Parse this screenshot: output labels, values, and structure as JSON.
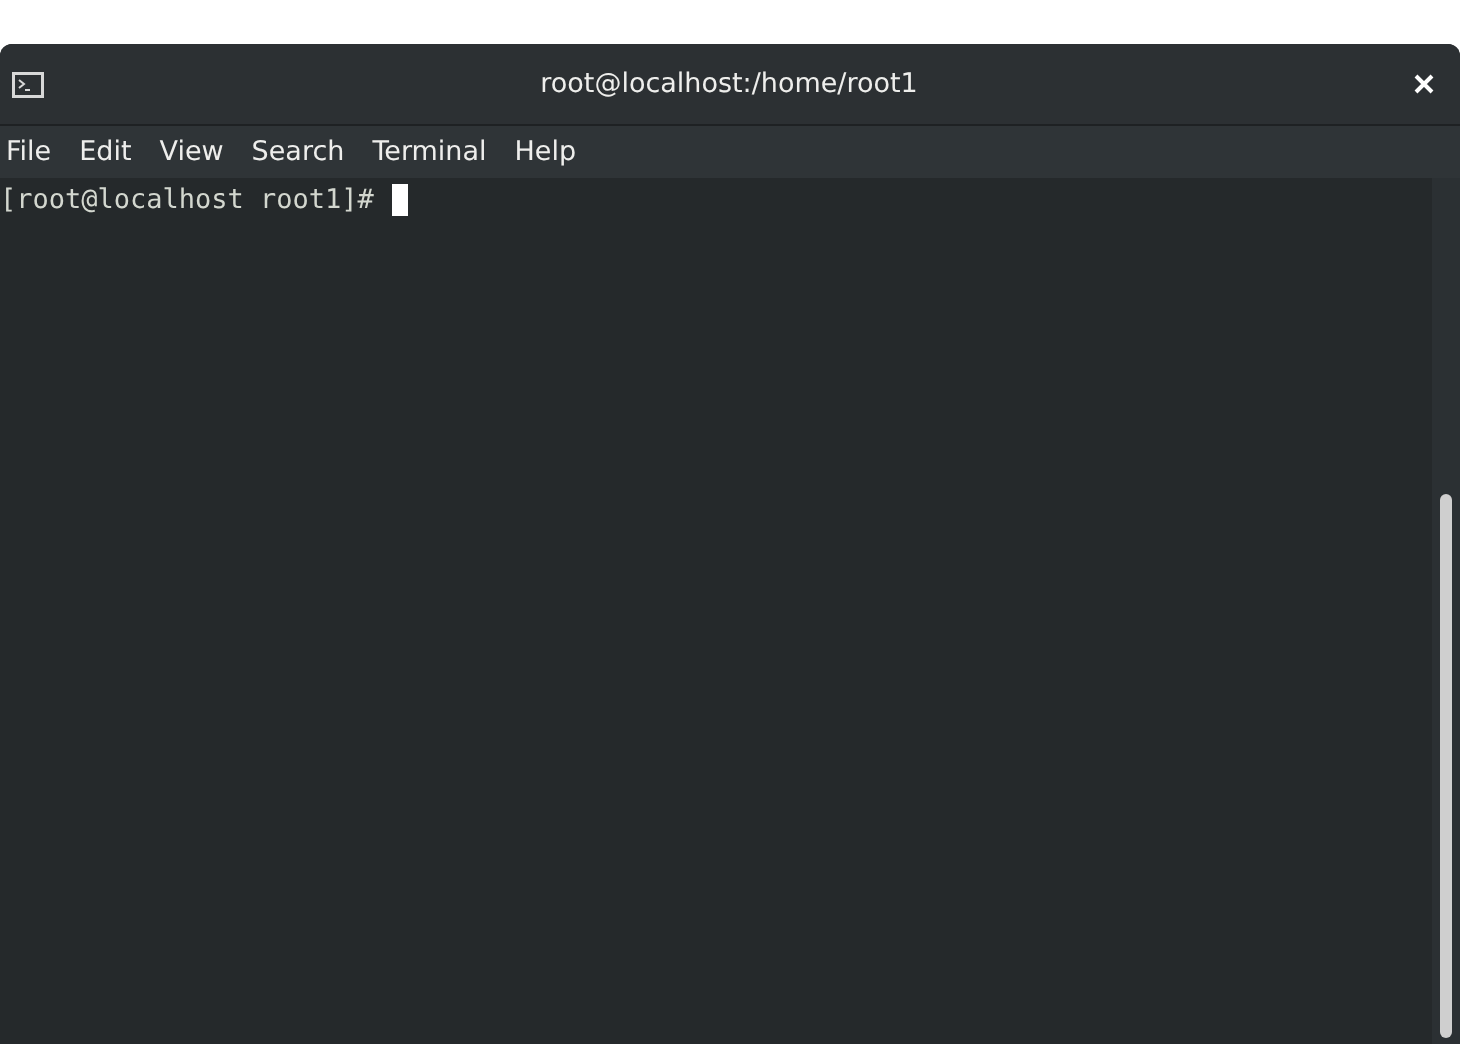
{
  "window": {
    "title": "root@localhost:/home/root1"
  },
  "menu": [
    {
      "label": "File"
    },
    {
      "label": "Edit"
    },
    {
      "label": "View"
    },
    {
      "label": "Search"
    },
    {
      "label": "Terminal"
    },
    {
      "label": "Help"
    }
  ],
  "terminal": {
    "lines": [
      "[root@localhost root1]#"
    ]
  }
}
